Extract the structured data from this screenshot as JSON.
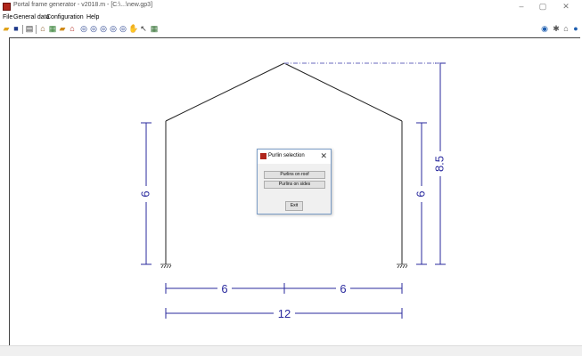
{
  "window": {
    "title": "Portal frame generator - v2018.m - [C:\\...\\new.gp3]",
    "minimize": "–",
    "maximize": "▢",
    "close": "✕"
  },
  "menu": {
    "items": [
      "File",
      "General data",
      "Configuration",
      "Help"
    ]
  },
  "toolbar": {
    "left_icons": [
      "open-folder-icon",
      "save-icon",
      "print-icon",
      "frame-icon",
      "load-icon",
      "folder-open-icon",
      "portal-icon",
      "zoom-window-icon",
      "zoom-extents-icon",
      "zoom-in-icon",
      "zoom-previous-icon",
      "zoom-out-icon",
      "pan-hand-icon",
      "pointer-icon",
      "calculator-icon"
    ],
    "right_icons": [
      "globe-icon",
      "settings-icon",
      "home-icon",
      "info-icon"
    ]
  },
  "drawing": {
    "dimensions": {
      "left_height": "6",
      "right_height": "6",
      "total_height": "8.5",
      "bay_left": "6",
      "bay_right": "6",
      "span": "12"
    },
    "colors": {
      "frame": "#222222",
      "dimension": "#2a2a9e",
      "roof_line": "#9b9bd4"
    }
  },
  "dialog": {
    "title": "Purlin selection",
    "close": "✕",
    "buttons": {
      "roof": "Purlins on roof",
      "sides": "Purlins on sides",
      "exit": "Exit"
    }
  }
}
